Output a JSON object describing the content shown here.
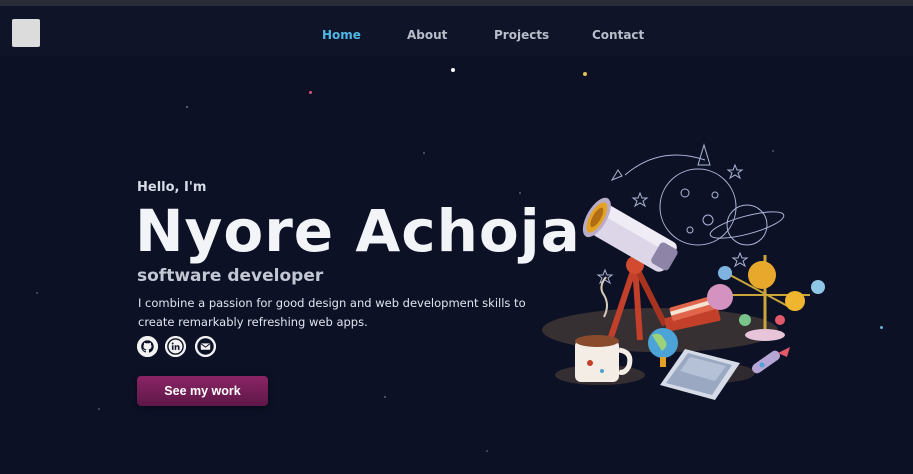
{
  "nav": {
    "links": [
      {
        "label": "Home",
        "active": true
      },
      {
        "label": "About",
        "active": false
      },
      {
        "label": "Projects",
        "active": false
      },
      {
        "label": "Contact",
        "active": false
      }
    ]
  },
  "hero": {
    "greeting": "Hello, I'm",
    "name": "Nyore Achoja",
    "role": "software developer",
    "description": "I combine a passion for good design and web development skills to create remarkably refreshing web apps.",
    "cta_label": "See my work"
  },
  "socials": [
    {
      "icon": "github-icon"
    },
    {
      "icon": "linkedin-icon"
    },
    {
      "icon": "email-icon"
    }
  ],
  "illustration": {
    "icon": "astronomy-illustration"
  },
  "colors": {
    "background": "#0c1126",
    "navbar": "#0f1429",
    "accent": "#4fb6e6",
    "cta": "#7a2060"
  }
}
